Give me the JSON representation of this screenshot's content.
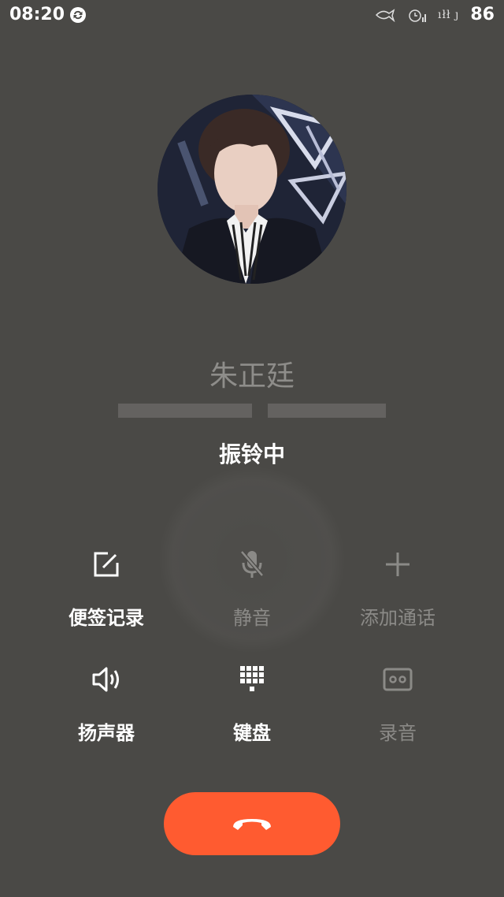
{
  "status_bar": {
    "time": "08:20",
    "signal_text": "ıłł ȷ",
    "battery": "86"
  },
  "caller": {
    "name": "朱正廷",
    "status": "振铃中"
  },
  "actions": [
    {
      "label": "便签记录",
      "icon": "note-edit-icon",
      "enabled": true
    },
    {
      "label": "静音",
      "icon": "mute-mic-icon",
      "enabled": false
    },
    {
      "label": "添加通话",
      "icon": "add-call-icon",
      "enabled": false
    },
    {
      "label": "扬声器",
      "icon": "speaker-icon",
      "enabled": true
    },
    {
      "label": "键盘",
      "icon": "keypad-icon",
      "enabled": true
    },
    {
      "label": "录音",
      "icon": "record-icon",
      "enabled": false
    }
  ],
  "colors": {
    "background": "#4a4946",
    "end_call": "#ff5b30",
    "disabled_text": "#8b8a87"
  }
}
